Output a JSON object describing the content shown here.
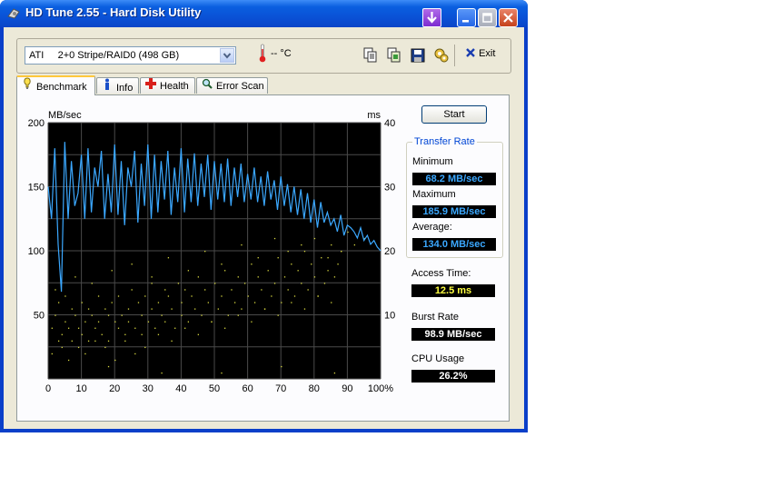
{
  "window": {
    "title": "HD Tune 2.55 - Hard Disk Utility"
  },
  "toolbar": {
    "drive": "ATI     2+0 Stripe/RAID0 (498 GB)",
    "temperature": "-- °C",
    "exit_label": "Exit"
  },
  "tabs": [
    {
      "label": "Benchmark",
      "icon": "benchmark-icon"
    },
    {
      "label": "Info",
      "icon": "info-icon"
    },
    {
      "label": "Health",
      "icon": "health-icon"
    },
    {
      "label": "Error Scan",
      "icon": "error-scan-icon"
    }
  ],
  "stats": {
    "start_label": "Start",
    "transfer_rate_title": "Transfer Rate",
    "minimum_label": "Minimum",
    "minimum_value": "68.2 MB/sec",
    "maximum_label": "Maximum",
    "maximum_value": "185.9 MB/sec",
    "average_label": "Average:",
    "average_value": "134.0 MB/sec",
    "access_time_label": "Access Time:",
    "access_time_value": "12.5 ms",
    "burst_rate_label": "Burst Rate",
    "burst_rate_value": "98.9 MB/sec",
    "cpu_usage_label": "CPU Usage",
    "cpu_usage_value": "26.2%"
  },
  "chart_data": {
    "type": "line",
    "left_unit": "MB/sec",
    "right_unit": "ms",
    "left_ticks": [
      "200",
      "150",
      "100",
      "50"
    ],
    "right_ticks": [
      "40",
      "30",
      "20",
      "10"
    ],
    "x_ticks": [
      "0",
      "10",
      "20",
      "30",
      "40",
      "50",
      "60",
      "70",
      "80",
      "90",
      "100%"
    ],
    "xlim": [
      0,
      100
    ],
    "ylim_left": [
      0,
      200
    ],
    "ylim_right": [
      0,
      40
    ],
    "grid": true,
    "colors": {
      "background": "#000000",
      "grid": "#4a4a4a",
      "transfer": "#3ba8ff",
      "access": "#d8d840"
    },
    "series": [
      {
        "type": "line",
        "x": [
          0,
          1,
          2,
          3,
          4,
          5,
          6,
          7,
          8,
          9,
          10,
          11,
          12,
          13,
          14,
          15,
          16,
          17,
          18,
          19,
          20,
          21,
          22,
          23,
          24,
          25,
          26,
          27,
          28,
          29,
          30,
          31,
          32,
          33,
          34,
          35,
          36,
          37,
          38,
          39,
          40,
          41,
          42,
          43,
          44,
          45,
          46,
          47,
          48,
          49,
          50,
          51,
          52,
          53,
          54,
          55,
          56,
          57,
          58,
          59,
          60,
          61,
          62,
          63,
          64,
          65,
          66,
          67,
          68,
          69,
          70,
          71,
          72,
          73,
          74,
          75,
          76,
          77,
          78,
          79,
          80,
          81,
          82,
          83,
          84,
          85,
          86,
          87,
          88,
          89,
          90,
          91,
          92,
          93,
          94,
          95,
          96,
          97,
          98,
          99,
          100
        ],
        "values": [
          150,
          125,
          180,
          105,
          68,
          185,
          125,
          170,
          135,
          145,
          175,
          125,
          180,
          130,
          165,
          150,
          178,
          125,
          160,
          130,
          183,
          128,
          170,
          120,
          165,
          150,
          178,
          122,
          168,
          135,
          183,
          125,
          175,
          130,
          170,
          140,
          178,
          128,
          165,
          138,
          180,
          130,
          172,
          138,
          176,
          135,
          168,
          142,
          175,
          132,
          170,
          140,
          168,
          138,
          172,
          135,
          165,
          142,
          168,
          138,
          160,
          140,
          165,
          138,
          158,
          135,
          162,
          140,
          155,
          132,
          158,
          135,
          152,
          130,
          150,
          128,
          148,
          125,
          145,
          122,
          140,
          118,
          138,
          122,
          130,
          120,
          125,
          115,
          128,
          112,
          120,
          118,
          115,
          110,
          118,
          108,
          112,
          105,
          108,
          103,
          100
        ]
      },
      {
        "type": "scatter",
        "note": "access time",
        "x": [
          1,
          2,
          3,
          3,
          4,
          5,
          5,
          6,
          7,
          7,
          8,
          9,
          10,
          10,
          11,
          12,
          12,
          13,
          14,
          15,
          15,
          16,
          17,
          18,
          18,
          19,
          20,
          21,
          21,
          22,
          23,
          24,
          24,
          25,
          26,
          27,
          28,
          28,
          29,
          30,
          31,
          31,
          32,
          33,
          34,
          35,
          35,
          36,
          37,
          38,
          39,
          40,
          40,
          41,
          42,
          43,
          44,
          45,
          46,
          47,
          48,
          49,
          50,
          51,
          52,
          53,
          54,
          55,
          56,
          57,
          58,
          59,
          60,
          61,
          62,
          63,
          64,
          65,
          66,
          67,
          68,
          69,
          70,
          71,
          72,
          73,
          74,
          75,
          76,
          77,
          78,
          79,
          80,
          81,
          82,
          83,
          84,
          85,
          86,
          87,
          88,
          1,
          4,
          6,
          9,
          11,
          14,
          17,
          20,
          23,
          26,
          29,
          33,
          37,
          41,
          45,
          49,
          53,
          57,
          61,
          65,
          69,
          73,
          77,
          81,
          85,
          2,
          8,
          13,
          19,
          25,
          31,
          36,
          42,
          47,
          52,
          58,
          63,
          68,
          72,
          76,
          80,
          84,
          88,
          90,
          92,
          95,
          18,
          34,
          52,
          70,
          86
        ],
        "values": [
          8,
          10,
          6,
          12,
          7,
          9,
          13,
          8,
          11,
          6,
          10,
          8,
          12,
          7,
          9,
          11,
          6,
          10,
          8,
          13,
          9,
          7,
          11,
          10,
          6,
          12,
          9,
          8,
          13,
          10,
          7,
          11,
          9,
          14,
          8,
          12,
          10,
          7,
          13,
          9,
          11,
          15,
          8,
          12,
          10,
          14,
          9,
          13,
          11,
          8,
          15,
          10,
          12,
          14,
          9,
          13,
          11,
          16,
          10,
          14,
          12,
          9,
          15,
          11,
          13,
          17,
          10,
          14,
          12,
          16,
          11,
          15,
          13,
          18,
          12,
          16,
          14,
          11,
          17,
          13,
          15,
          19,
          12,
          16,
          14,
          18,
          13,
          17,
          15,
          20,
          14,
          18,
          16,
          13,
          19,
          15,
          17,
          21,
          16,
          18,
          20,
          4,
          5,
          3,
          5,
          4,
          6,
          5,
          3,
          6,
          4,
          5,
          7,
          6,
          8,
          7,
          9,
          8,
          10,
          9,
          11,
          10,
          12,
          11,
          13,
          12,
          14,
          16,
          15,
          17,
          18,
          16,
          19,
          17,
          20,
          18,
          21,
          19,
          22,
          20,
          21,
          22,
          19,
          20,
          23,
          21,
          22,
          2,
          1,
          1,
          2,
          1
        ]
      }
    ]
  }
}
